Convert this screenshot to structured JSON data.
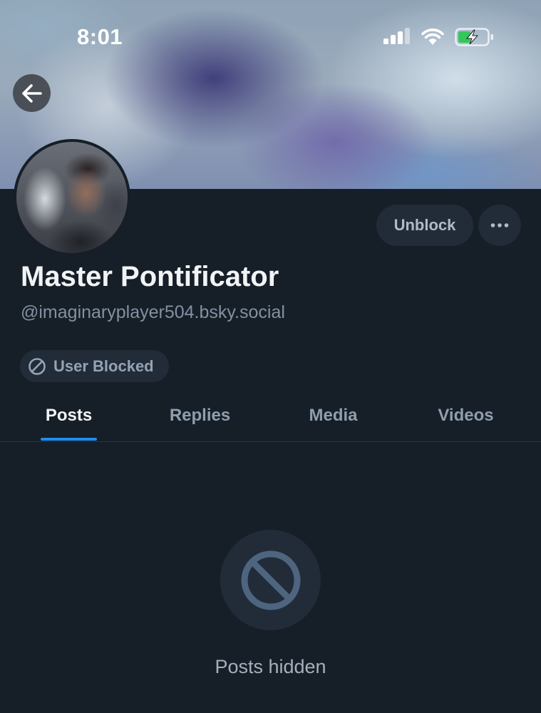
{
  "status_bar": {
    "time": "8:01",
    "signal_icon": "cellular-signal-icon",
    "wifi_icon": "wifi-icon",
    "battery_icon": "battery-charging-icon",
    "battery_color": "#34c759"
  },
  "header": {
    "back_icon": "arrow-left-icon"
  },
  "profile": {
    "display_name": "Master Pontificator",
    "handle": "@imaginaryplayer504.bsky.social",
    "blocked_label": "User Blocked",
    "blocked_icon": "block-icon"
  },
  "actions": {
    "unblock_label": "Unblock",
    "more_icon": "ellipsis-icon"
  },
  "tabs": [
    {
      "label": "Posts",
      "active": true
    },
    {
      "label": "Replies",
      "active": false
    },
    {
      "label": "Media",
      "active": false
    },
    {
      "label": "Videos",
      "active": false
    }
  ],
  "empty_state": {
    "icon": "block-icon",
    "text": "Posts hidden"
  },
  "colors": {
    "background": "#161e27",
    "accent": "#1f8cf1",
    "pill": "#222c38"
  }
}
